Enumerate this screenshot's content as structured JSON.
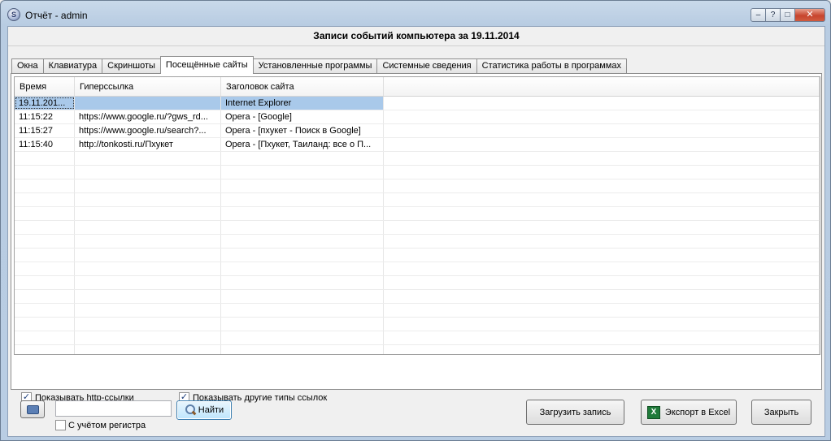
{
  "window": {
    "title": "Отчёт - admin",
    "controls": {
      "help": "?",
      "minimize": "–",
      "restore": "□",
      "close": "✕"
    }
  },
  "header": {
    "title": "Записи событий компьютера за 19.11.2014"
  },
  "tabs": [
    {
      "label": "Окна"
    },
    {
      "label": "Клавиатура"
    },
    {
      "label": "Скриншоты"
    },
    {
      "label": "Посещённые сайты",
      "active": true
    },
    {
      "label": "Установленные программы"
    },
    {
      "label": "Системные сведения"
    },
    {
      "label": "Статистика работы в программах"
    }
  ],
  "grid": {
    "columns": [
      "Время",
      "Гиперссылка",
      "Заголовок сайта",
      ""
    ],
    "rows": [
      [
        "19.11.201...",
        "",
        "Internet Explorer"
      ],
      [
        "11:15:22",
        "https://www.google.ru/?gws_rd...",
        "Opera - [Google]"
      ],
      [
        "11:15:27",
        "https://www.google.ru/search?...",
        "Opera - [пхукет - Поиск в Google]"
      ],
      [
        "11:15:40",
        "http://tonkosti.ru/Пхукет",
        "Opera - [Пхукет, Таиланд: все о П..."
      ]
    ],
    "selected_row": 0
  },
  "filters": {
    "show_http": {
      "label": "Показывать http-ссылки",
      "checked": true
    },
    "show_other": {
      "label": "Показывать другие типы ссылок",
      "checked": true
    }
  },
  "search": {
    "value": "",
    "find_label": "Найти",
    "case_sensitive": {
      "label": "С учётом регистра",
      "checked": false
    }
  },
  "buttons": {
    "load": "Загрузить запись",
    "export": "Экспорт в Excel",
    "close": "Закрыть"
  },
  "icons": {
    "app": "app-logo-icon",
    "print": "printer-icon",
    "find": "magnifier-icon",
    "excel": "excel-icon"
  }
}
